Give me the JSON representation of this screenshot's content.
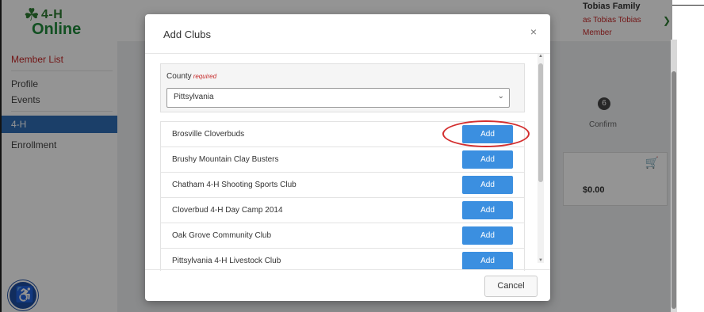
{
  "app": {
    "logo": {
      "brand": "4-H",
      "sub": "Online"
    },
    "sidebar": {
      "member_list": "Member List",
      "items": [
        "Profile",
        "Events",
        "4-H",
        "Enrollment"
      ]
    },
    "user": {
      "name": "Tobias Family",
      "as": "as Tobias Tobias",
      "role": "Member"
    },
    "steps": {
      "number": "6",
      "label": "Confirm"
    },
    "cart": {
      "total": "$0.00"
    }
  },
  "modal": {
    "title": "Add Clubs",
    "close": "×",
    "county": {
      "label": "County",
      "required": "required",
      "selected": "Pittsylvania"
    },
    "add_label": "Add",
    "clubs": [
      "Brosville Cloverbuds",
      "Brushy Mountain Clay Busters",
      "Chatham 4-H Shooting Sports Club",
      "Cloverbud 4-H Day Camp 2014",
      "Oak Grove Community Club",
      "Pittsylvania 4-H Livestock Club"
    ],
    "cancel": "Cancel"
  },
  "colors": {
    "accent": "#3b8fe0",
    "brand_green": "#2e7d32",
    "active_nav": "#2f6db5",
    "annotation": "#d32f2f"
  }
}
